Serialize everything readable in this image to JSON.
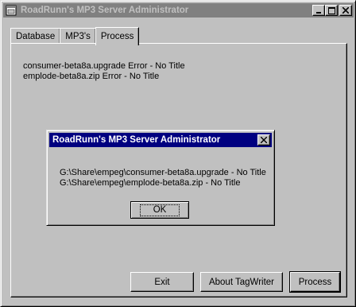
{
  "window": {
    "title": "RoadRunn's MP3 Server Administrator",
    "controls": {
      "minimize": "_",
      "maximize": "□",
      "close": "×"
    }
  },
  "tabs": [
    {
      "label": "Database"
    },
    {
      "label": "MP3's"
    },
    {
      "label": "Process",
      "active": true
    }
  ],
  "log": [
    "consumer-beta8a.upgrade Error - No Title",
    "emplode-beta8a.zip Error - No Title"
  ],
  "buttons": {
    "exit": "Exit",
    "about": "About TagWriter",
    "process": "Process"
  },
  "dialog": {
    "title": "RoadRunn's MP3 Server Administrator",
    "close": "×",
    "lines": [
      "G:\\Share\\empeg\\consumer-beta8a.upgrade - No Title",
      "G:\\Share\\empeg\\emplode-beta8a.zip - No Title"
    ],
    "ok": "OK"
  },
  "colors": {
    "face": "#c0c0c0",
    "inactive_title": "#808080",
    "active_title": "#000080"
  }
}
